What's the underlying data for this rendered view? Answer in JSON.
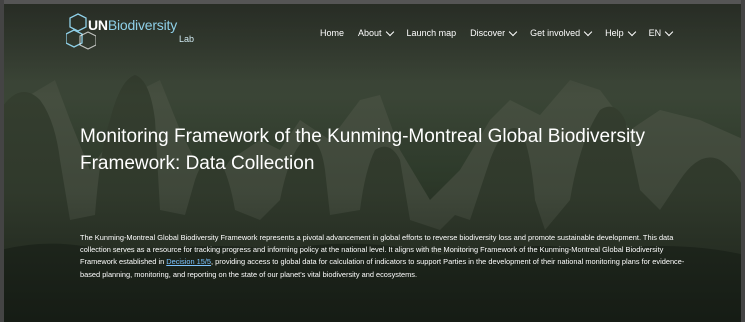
{
  "logo": {
    "brand_un": "UN",
    "brand_bio": "Biodiversity",
    "brand_lab": "Lab",
    "icon": "hexagon-logo-icon"
  },
  "nav": {
    "home": "Home",
    "about": "About",
    "launch_map": "Launch map",
    "discover": "Discover",
    "get_involved": "Get involved",
    "help": "Help",
    "language": "EN"
  },
  "hero": {
    "title": "Monitoring Framework of the Kunming-Montreal Global Biodiversity Framework: Data Collection",
    "intro_before_link": "The Kunming-Montreal Global Biodiversity Framework represents a pivotal advancement in global efforts to reverse biodiversity loss and promote sustainable development. This data collection serves as a resource for tracking progress and informing policy at the national level. It aligns with the Monitoring Framework of the Kunming-Montreal Global Biodiversity Framework established in ",
    "intro_link": "Decision 15/5",
    "intro_after_link": ", providing access to global data for calculation of indicators to support Parties in the development of their national monitoring plans for evidence-based planning, monitoring, and reporting on the state of our planet's vital biodiversity and ecosystems."
  },
  "colors": {
    "link": "#7cc3ff",
    "logo_accent": "#8fd0e8"
  }
}
